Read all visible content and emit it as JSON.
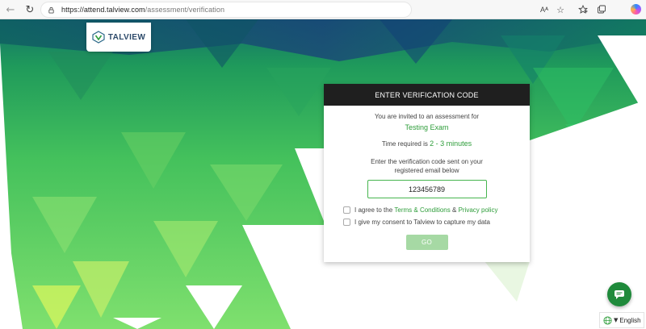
{
  "browser": {
    "url_host": "https://attend.talview.com",
    "url_path": "/assessment/verification",
    "read_aloud_label": "Aᴬ"
  },
  "logo": {
    "text": "TALVIEW"
  },
  "card": {
    "heading": "ENTER VERIFICATION CODE",
    "invite_text": "You are invited to an assessment for",
    "exam_name": "Testing Exam",
    "time_prefix": "Time required is",
    "time_value": "2 - 3 minutes",
    "instruction_line1": "Enter the verification code sent on your",
    "instruction_line2": "registered email below",
    "code_value": "123456789",
    "agree_prefix": "I agree to the",
    "terms_link": "Terms & Conditions",
    "amp": "&",
    "privacy_link": "Privacy policy",
    "consent_text": "I give my consent to Talview to capture my data",
    "go_label": "GO"
  },
  "language": {
    "label": "English"
  },
  "colors": {
    "accent": "#2e9d3a",
    "header": "#1f1f1f",
    "go_disabled": "#a6d9a4",
    "chat": "#1f8a3b"
  },
  "icons": [
    "back-arrow-icon",
    "reload-icon",
    "lock-icon",
    "read-aloud-icon",
    "favorite-star-icon",
    "favorites-icon",
    "collections-icon",
    "copilot-icon",
    "chat-icon",
    "globe-icon",
    "chevron-down-icon"
  ]
}
